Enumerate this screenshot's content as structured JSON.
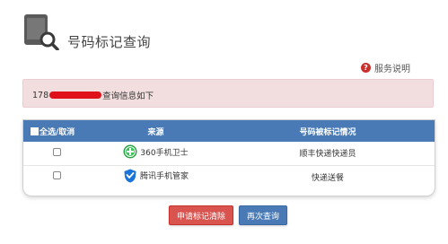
{
  "header": {
    "title": "号码标记查询"
  },
  "help": {
    "label": "服务说明"
  },
  "alert": {
    "prefix": "178",
    "suffix": "查询信息如下"
  },
  "table": {
    "columns": {
      "select": "全选/取消",
      "source": "来源",
      "status": "号码被标记情况"
    },
    "rows": [
      {
        "source": "360手机卫士",
        "icon": "360-security-icon",
        "status": "顺丰快递快递员"
      },
      {
        "source": "腾讯手机管家",
        "icon": "tencent-manager-icon",
        "status": "快递送餐"
      }
    ]
  },
  "buttons": {
    "clear": "申请标记清除",
    "requery": "再次查询"
  },
  "colors": {
    "accent": "#4a7ab5",
    "danger": "#d9534f",
    "alert_bg": "#f2dede"
  }
}
